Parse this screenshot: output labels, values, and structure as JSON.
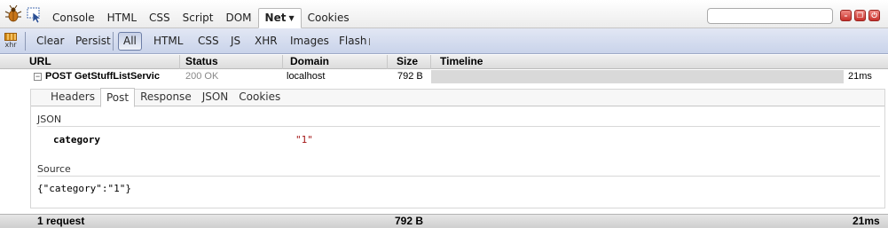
{
  "toolbar": {
    "icons": {
      "firebug": "firebug-bug-icon",
      "inspect": "inspect-element-icon"
    },
    "tabs": [
      {
        "label": "Console",
        "active": false
      },
      {
        "label": "HTML",
        "active": false
      },
      {
        "label": "CSS",
        "active": false
      },
      {
        "label": "Script",
        "active": false
      },
      {
        "label": "DOM",
        "active": false
      },
      {
        "label": "Net",
        "active": true,
        "has_menu": true
      },
      {
        "label": "Cookies",
        "active": false
      }
    ],
    "search": {
      "value": "",
      "placeholder": ""
    },
    "window_buttons": [
      "minimize-icon",
      "restore-icon",
      "close-icon"
    ]
  },
  "filter_bar": {
    "xhr_icon_label": "xhr",
    "clear_label": "Clear",
    "persist_label": "Persist",
    "filters": [
      {
        "label": "All",
        "checked": true
      },
      {
        "label": "HTML",
        "checked": false
      },
      {
        "label": "CSS",
        "checked": false
      },
      {
        "label": "JS",
        "checked": false
      },
      {
        "label": "XHR",
        "checked": false
      },
      {
        "label": "Images",
        "checked": false
      },
      {
        "label": "Flash",
        "checked": false
      }
    ]
  },
  "columns": {
    "url": "URL",
    "status": "Status",
    "domain": "Domain",
    "size": "Size",
    "timeline": "Timeline"
  },
  "request": {
    "expanded": true,
    "toggle_symbol": "−",
    "url": "POST GetStuffListServic",
    "status": "200 OK",
    "domain": "localhost",
    "size": "792 B",
    "time": "21ms"
  },
  "details": {
    "tabs": [
      {
        "label": "Headers",
        "active": false
      },
      {
        "label": "Post",
        "active": true
      },
      {
        "label": "Response",
        "active": false
      },
      {
        "label": "JSON",
        "active": false
      },
      {
        "label": "Cookies",
        "active": false
      }
    ],
    "json_section_title": "JSON",
    "json_key": "category",
    "json_value": "\"1\"",
    "source_section_title": "Source",
    "source_text": "{\"category\":\"1\"}"
  },
  "summary": {
    "requests": "1 request",
    "size": "792 B",
    "time": "21ms"
  },
  "colors": {
    "filter_bar_bg": "#c9d3ea",
    "json_value_color": "#a31515",
    "timeline_bar": "#d9d9d9",
    "window_button": "#c8312b"
  }
}
